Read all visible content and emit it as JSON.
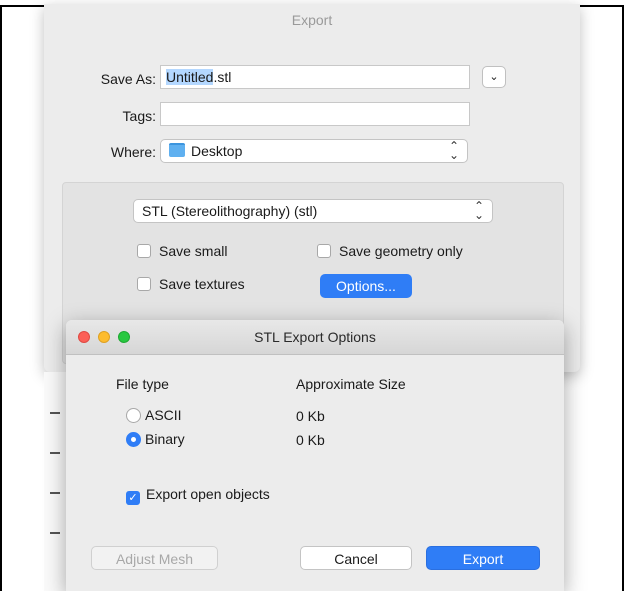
{
  "save_sheet": {
    "title": "Export",
    "save_as_label": "Save As:",
    "filename_selected": "Untitled",
    "filename_ext": ".stl",
    "expand_icon": "chevron-down-icon",
    "tags_label": "Tags:",
    "tags_value": "",
    "where_label": "Where:",
    "where_value": "Desktop",
    "format_value": "STL (Stereolithography) (stl)",
    "save_small_label": "Save small",
    "save_geometry_only_label": "Save geometry only",
    "save_textures_label": "Save textures",
    "options_button": "Options..."
  },
  "stl_dialog": {
    "title": "STL Export Options",
    "file_type_header": "File type",
    "approx_size_header": "Approximate Size",
    "options": [
      {
        "label": "ASCII",
        "size": "0 Kb",
        "selected": false
      },
      {
        "label": "Binary",
        "size": "0 Kb",
        "selected": true
      }
    ],
    "export_open_objects_label": "Export open objects",
    "export_open_objects_checked": true,
    "adjust_mesh_button": "Adjust Mesh",
    "cancel_button": "Cancel",
    "export_button": "Export"
  },
  "colors": {
    "accent": "#2f7df6",
    "close": "#fc5f57",
    "minimize": "#fdbc2e",
    "zoom": "#28c840"
  }
}
